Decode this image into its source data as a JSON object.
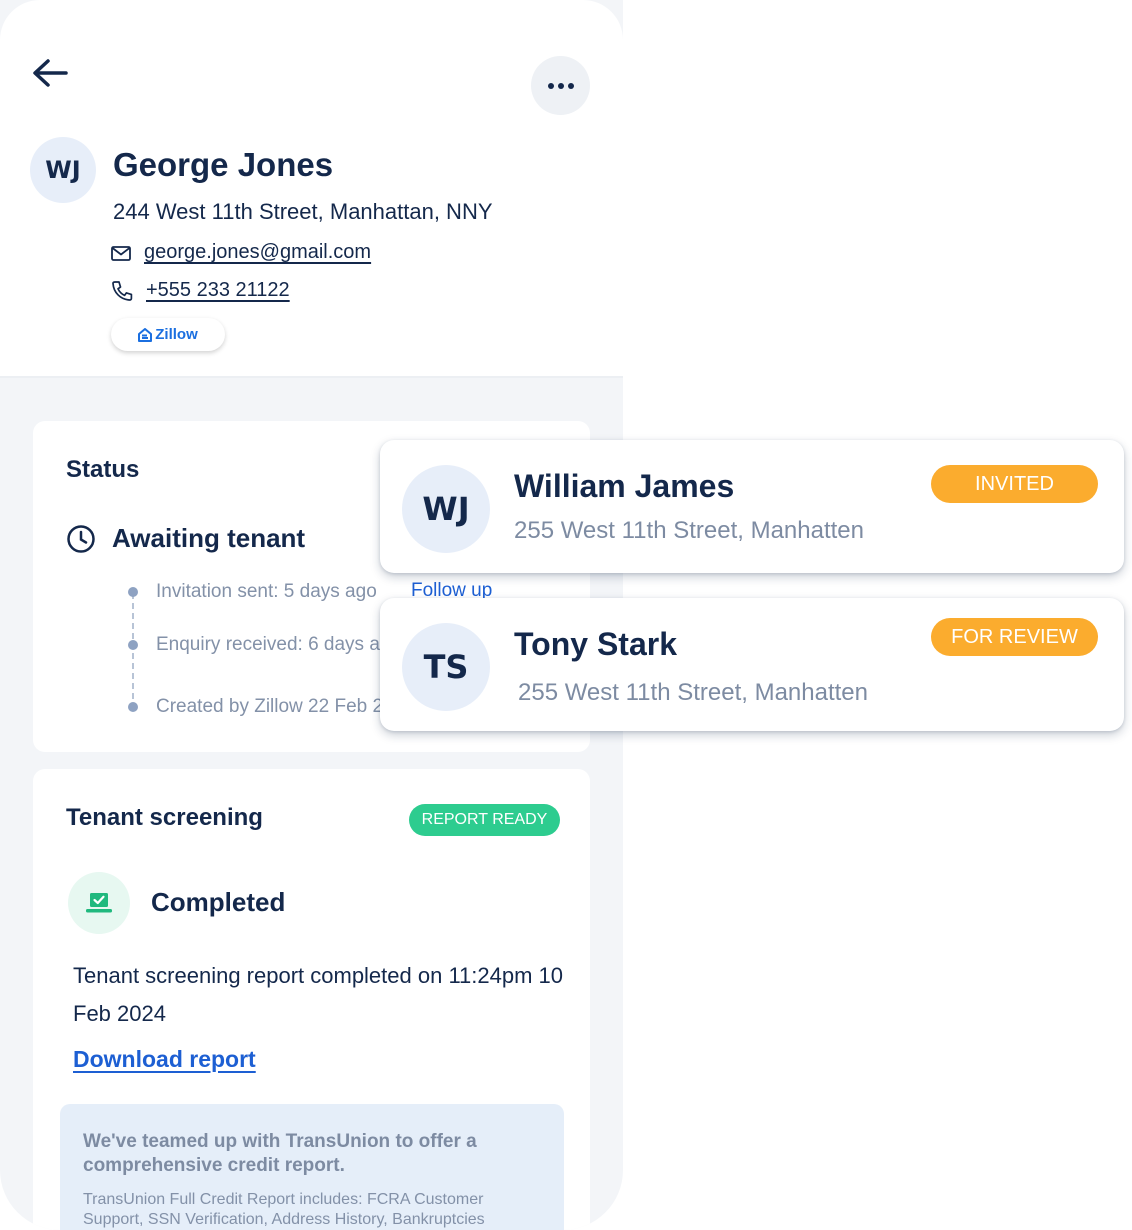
{
  "contact": {
    "initials": "WJ",
    "name": "George Jones",
    "address": "244 West 11th Street, Manhattan, NNY",
    "email": "george.jones@gmail.com",
    "phone": "+555 233 21122",
    "source": "Zillow"
  },
  "icons": {
    "back": "arrow-left-icon",
    "more": "more-horizontal-icon",
    "mail": "mail-icon",
    "phone": "phone-icon",
    "zillow": "zillow-logo-icon",
    "clock": "clock-icon",
    "completed": "laptop-check-icon"
  },
  "status": {
    "title": "Status",
    "state": "Awaiting tenant",
    "follow_up": "Follow up",
    "timeline": [
      "Invitation sent: 5 days ago",
      "Enquiry received: 6 days a",
      "Created by Zillow 22 Feb 2"
    ]
  },
  "screening": {
    "title": "Tenant screening",
    "badge": "REPORT READY",
    "state": "Completed",
    "description": "Tenant screening report completed on 11:24pm 10 Feb 2024",
    "download": "Download report",
    "promo_title": "We've teamed up with TransUnion to offer a comprehensive credit report.",
    "promo_body": "TransUnion Full Credit Report includes: FCRA Customer Support, SSN Verification, Address History, Bankruptcies"
  },
  "tenants": [
    {
      "initials": "WJ",
      "name": "William James",
      "address": "255 West 11th Street, Manhatten",
      "badge": "INVITED"
    },
    {
      "initials": "TS",
      "name": "Tony Stark",
      "address": "255 West 11th Street, Manhatten",
      "badge": "FOR REVIEW"
    }
  ],
  "colors": {
    "navy": "#14284b",
    "link": "#1d5fd3",
    "report_ready": "#2dcc8f",
    "pending": "#fbac2e",
    "muted": "#8391a8"
  }
}
